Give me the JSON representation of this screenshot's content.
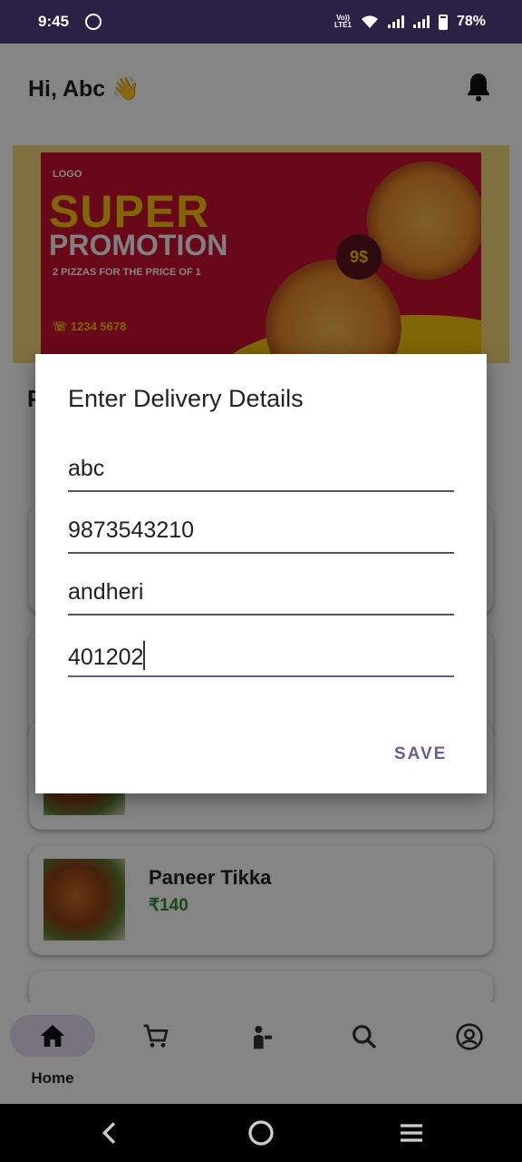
{
  "status_bar": {
    "time": "9:45",
    "network_label_top": "Vo))",
    "network_label_bottom": "LTE1",
    "battery_percent": "78%"
  },
  "header": {
    "greeting": "Hi, Abc 👋"
  },
  "promo": {
    "logo_text": "LOGO",
    "headline": "SUPER",
    "subheadline": "PROMOTION",
    "tagline": "2 PIZZAS FOR THE PRICE OF 1",
    "price": "9$",
    "phone": "1234 5678"
  },
  "section_letter": "P",
  "menu_items": [
    {
      "name": "Paneer Tikka",
      "price": "₹140"
    }
  ],
  "dialog": {
    "title": "Enter Delivery Details",
    "fields": [
      {
        "value": "abc"
      },
      {
        "value": "9873543210"
      },
      {
        "value": "andheri"
      },
      {
        "value": "401202"
      }
    ],
    "save_label": "SAVE"
  },
  "bottom_nav": {
    "items": [
      {
        "label": "Home",
        "icon": "home-icon",
        "active": true
      },
      {
        "label": "",
        "icon": "cart-icon",
        "active": false
      },
      {
        "label": "",
        "icon": "chef-icon",
        "active": false
      },
      {
        "label": "",
        "icon": "search-icon",
        "active": false
      },
      {
        "label": "",
        "icon": "profile-icon",
        "active": false
      }
    ]
  },
  "colors": {
    "status_bar": "#2a2145",
    "accent": "#6b5b95",
    "price_green": "#2e8b2e",
    "promo_red": "#c8102e",
    "promo_yellow": "#f6c40c"
  }
}
